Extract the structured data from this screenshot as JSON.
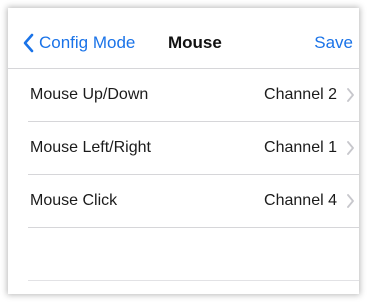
{
  "navbar": {
    "back_label": "Config Mode",
    "title": "Mouse",
    "save_label": "Save"
  },
  "rows": [
    {
      "label": "Mouse Up/Down",
      "value": "Channel 2"
    },
    {
      "label": "Mouse Left/Right",
      "value": "Channel 1"
    },
    {
      "label": "Mouse Click",
      "value": "Channel 4"
    }
  ],
  "icons": {
    "back": "chevron-left-icon",
    "disclosure": "chevron-right-icon"
  },
  "colors": {
    "accent": "#1a73e8",
    "separator": "#d6d6d9",
    "chevron": "#c7c7cc",
    "text": "#1b1b1b"
  }
}
